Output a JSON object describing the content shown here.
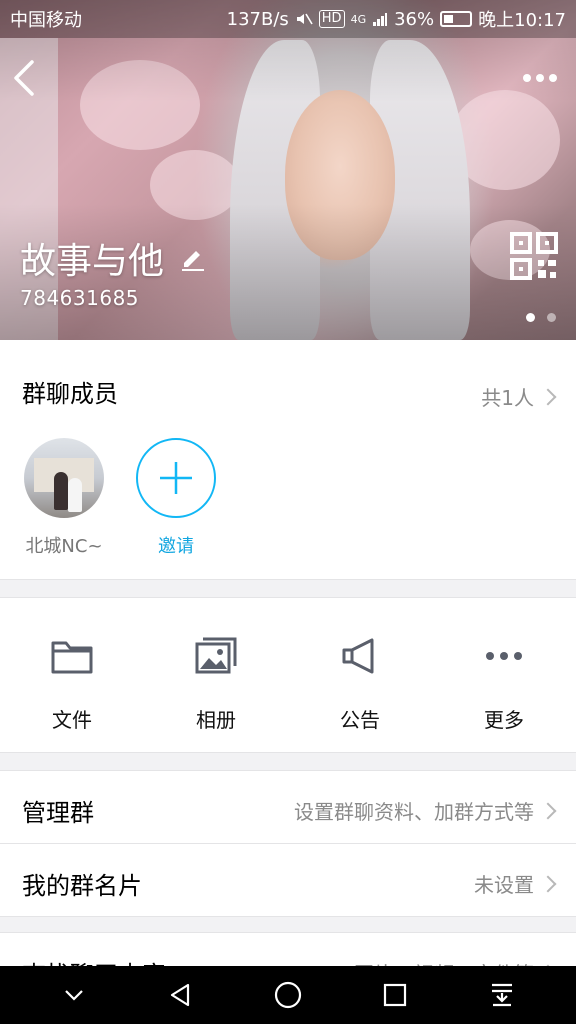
{
  "status_bar": {
    "carrier": "中国移动",
    "speed": "137B/s",
    "hd": "HD",
    "network": "4G",
    "battery": "36%",
    "battery_level": 0.36,
    "time": "晚上10:17"
  },
  "header": {
    "group_name": "故事与他",
    "group_id": "784631685",
    "page_count": 2,
    "active_page": 1
  },
  "members": {
    "title": "群聊成员",
    "count": "共1人",
    "list": [
      {
        "name": "北城NC~"
      }
    ],
    "invite_label": "邀请"
  },
  "actions": [
    {
      "label": "文件",
      "icon": "folder-icon"
    },
    {
      "label": "相册",
      "icon": "photo-album-icon"
    },
    {
      "label": "公告",
      "icon": "megaphone-icon"
    },
    {
      "label": "更多",
      "icon": "more-dots-icon"
    }
  ],
  "rows": [
    {
      "title": "管理群",
      "value": "设置群聊资料、加群方式等"
    },
    {
      "title": "我的群名片",
      "value": "未设置"
    },
    {
      "title": "查找聊天内容",
      "value": "图片、视频、文件等"
    }
  ],
  "colors": {
    "accent": "#12b7f5",
    "icon_gray": "#5a5f6b",
    "text_secondary": "#8a8a8a"
  }
}
